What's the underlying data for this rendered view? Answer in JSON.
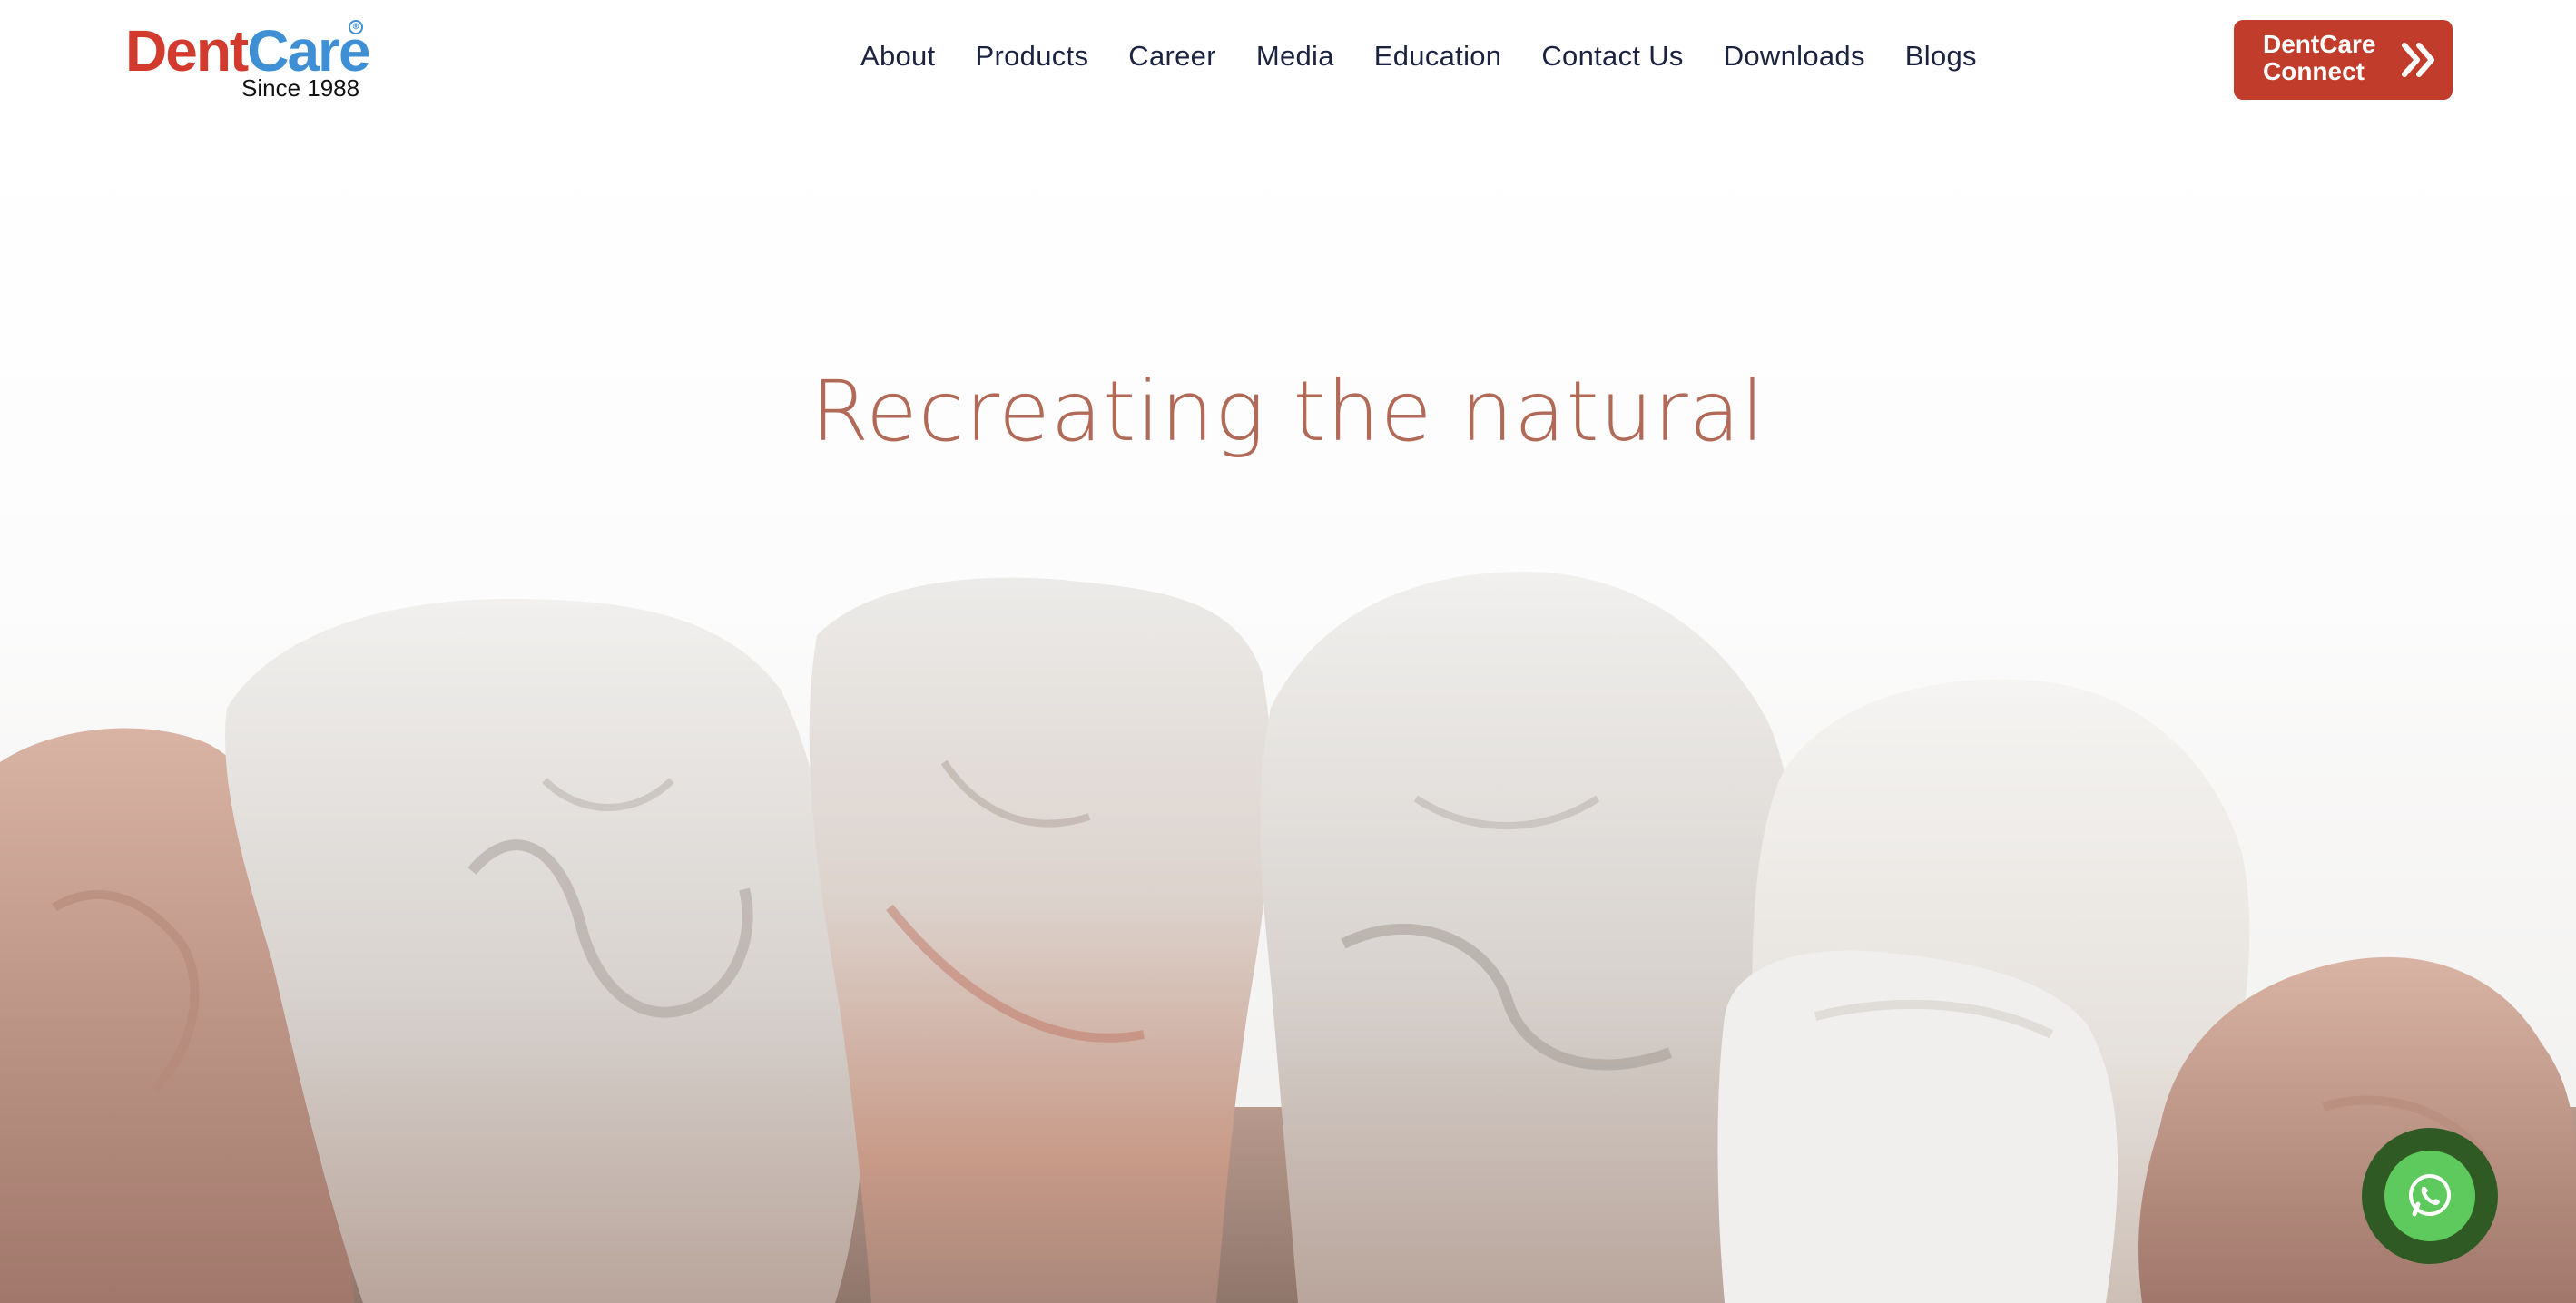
{
  "brand": {
    "name_part1": "Dent",
    "name_part2": "Care",
    "registered_mark": "®",
    "tagline": "Since 1988"
  },
  "nav": {
    "items": [
      {
        "label": "About"
      },
      {
        "label": "Products"
      },
      {
        "label": "Career"
      },
      {
        "label": "Media"
      },
      {
        "label": "Education"
      },
      {
        "label": "Contact Us"
      },
      {
        "label": "Downloads"
      },
      {
        "label": "Blogs"
      }
    ]
  },
  "cta": {
    "line1": "DentCare",
    "line2": "Connect",
    "icon": "double-chevron-right-icon"
  },
  "hero": {
    "title": "Recreating the natural",
    "image": "dental-crowns-closeup-image"
  },
  "whatsapp": {
    "icon": "whatsapp-icon"
  },
  "colors": {
    "brand_red": "#c13c2a",
    "brand_blue": "#3e8fd4",
    "nav_text": "#1c2340",
    "hero_title": "#b06a57",
    "whatsapp_green": "#5ec95d",
    "whatsapp_ring": "#2f5a23"
  }
}
